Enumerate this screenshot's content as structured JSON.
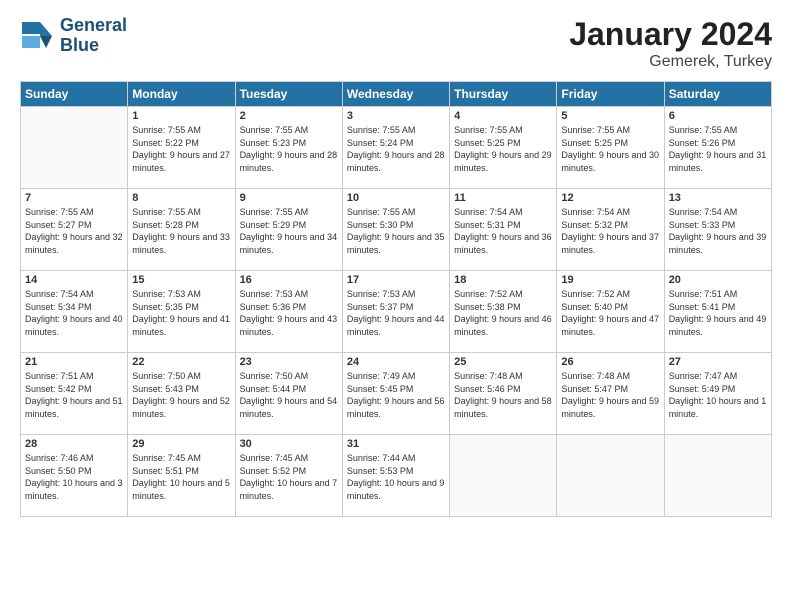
{
  "logo": {
    "line1": "General",
    "line2": "Blue"
  },
  "header": {
    "month": "January 2024",
    "location": "Gemerek, Turkey"
  },
  "columns": [
    "Sunday",
    "Monday",
    "Tuesday",
    "Wednesday",
    "Thursday",
    "Friday",
    "Saturday"
  ],
  "weeks": [
    [
      {
        "day": "",
        "empty": true
      },
      {
        "day": "1",
        "sunrise": "7:55 AM",
        "sunset": "5:22 PM",
        "daylight": "9 hours and 27 minutes."
      },
      {
        "day": "2",
        "sunrise": "7:55 AM",
        "sunset": "5:23 PM",
        "daylight": "9 hours and 28 minutes."
      },
      {
        "day": "3",
        "sunrise": "7:55 AM",
        "sunset": "5:24 PM",
        "daylight": "9 hours and 28 minutes."
      },
      {
        "day": "4",
        "sunrise": "7:55 AM",
        "sunset": "5:25 PM",
        "daylight": "9 hours and 29 minutes."
      },
      {
        "day": "5",
        "sunrise": "7:55 AM",
        "sunset": "5:25 PM",
        "daylight": "9 hours and 30 minutes."
      },
      {
        "day": "6",
        "sunrise": "7:55 AM",
        "sunset": "5:26 PM",
        "daylight": "9 hours and 31 minutes."
      }
    ],
    [
      {
        "day": "7",
        "sunrise": "7:55 AM",
        "sunset": "5:27 PM",
        "daylight": "9 hours and 32 minutes."
      },
      {
        "day": "8",
        "sunrise": "7:55 AM",
        "sunset": "5:28 PM",
        "daylight": "9 hours and 33 minutes."
      },
      {
        "day": "9",
        "sunrise": "7:55 AM",
        "sunset": "5:29 PM",
        "daylight": "9 hours and 34 minutes."
      },
      {
        "day": "10",
        "sunrise": "7:55 AM",
        "sunset": "5:30 PM",
        "daylight": "9 hours and 35 minutes."
      },
      {
        "day": "11",
        "sunrise": "7:54 AM",
        "sunset": "5:31 PM",
        "daylight": "9 hours and 36 minutes."
      },
      {
        "day": "12",
        "sunrise": "7:54 AM",
        "sunset": "5:32 PM",
        "daylight": "9 hours and 37 minutes."
      },
      {
        "day": "13",
        "sunrise": "7:54 AM",
        "sunset": "5:33 PM",
        "daylight": "9 hours and 39 minutes."
      }
    ],
    [
      {
        "day": "14",
        "sunrise": "7:54 AM",
        "sunset": "5:34 PM",
        "daylight": "9 hours and 40 minutes."
      },
      {
        "day": "15",
        "sunrise": "7:53 AM",
        "sunset": "5:35 PM",
        "daylight": "9 hours and 41 minutes."
      },
      {
        "day": "16",
        "sunrise": "7:53 AM",
        "sunset": "5:36 PM",
        "daylight": "9 hours and 43 minutes."
      },
      {
        "day": "17",
        "sunrise": "7:53 AM",
        "sunset": "5:37 PM",
        "daylight": "9 hours and 44 minutes."
      },
      {
        "day": "18",
        "sunrise": "7:52 AM",
        "sunset": "5:38 PM",
        "daylight": "9 hours and 46 minutes."
      },
      {
        "day": "19",
        "sunrise": "7:52 AM",
        "sunset": "5:40 PM",
        "daylight": "9 hours and 47 minutes."
      },
      {
        "day": "20",
        "sunrise": "7:51 AM",
        "sunset": "5:41 PM",
        "daylight": "9 hours and 49 minutes."
      }
    ],
    [
      {
        "day": "21",
        "sunrise": "7:51 AM",
        "sunset": "5:42 PM",
        "daylight": "9 hours and 51 minutes."
      },
      {
        "day": "22",
        "sunrise": "7:50 AM",
        "sunset": "5:43 PM",
        "daylight": "9 hours and 52 minutes."
      },
      {
        "day": "23",
        "sunrise": "7:50 AM",
        "sunset": "5:44 PM",
        "daylight": "9 hours and 54 minutes."
      },
      {
        "day": "24",
        "sunrise": "7:49 AM",
        "sunset": "5:45 PM",
        "daylight": "9 hours and 56 minutes."
      },
      {
        "day": "25",
        "sunrise": "7:48 AM",
        "sunset": "5:46 PM",
        "daylight": "9 hours and 58 minutes."
      },
      {
        "day": "26",
        "sunrise": "7:48 AM",
        "sunset": "5:47 PM",
        "daylight": "9 hours and 59 minutes."
      },
      {
        "day": "27",
        "sunrise": "7:47 AM",
        "sunset": "5:49 PM",
        "daylight": "10 hours and 1 minute."
      }
    ],
    [
      {
        "day": "28",
        "sunrise": "7:46 AM",
        "sunset": "5:50 PM",
        "daylight": "10 hours and 3 minutes."
      },
      {
        "day": "29",
        "sunrise": "7:45 AM",
        "sunset": "5:51 PM",
        "daylight": "10 hours and 5 minutes."
      },
      {
        "day": "30",
        "sunrise": "7:45 AM",
        "sunset": "5:52 PM",
        "daylight": "10 hours and 7 minutes."
      },
      {
        "day": "31",
        "sunrise": "7:44 AM",
        "sunset": "5:53 PM",
        "daylight": "10 hours and 9 minutes."
      },
      {
        "day": "",
        "empty": true
      },
      {
        "day": "",
        "empty": true
      },
      {
        "day": "",
        "empty": true
      }
    ]
  ]
}
